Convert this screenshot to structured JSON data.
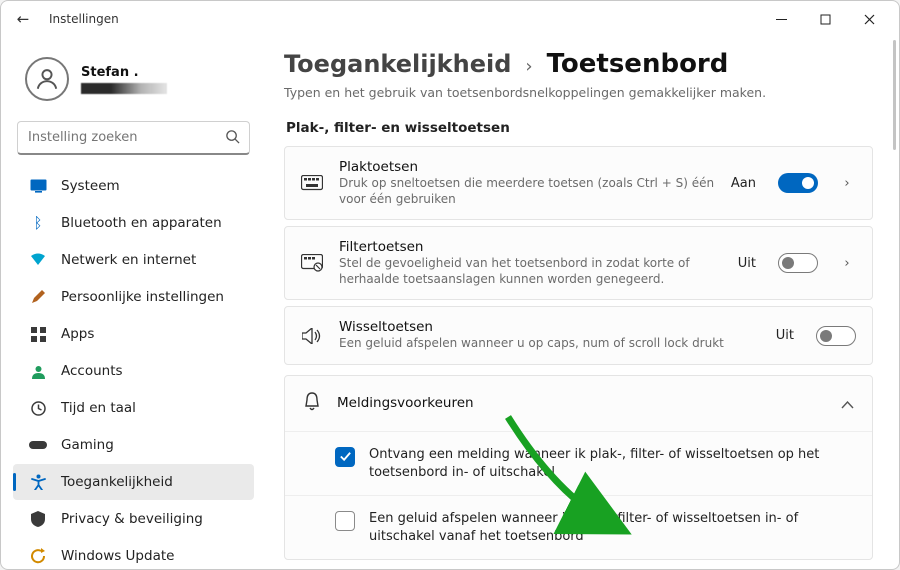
{
  "window": {
    "title": "Instellingen"
  },
  "profile": {
    "name": "Stefan ."
  },
  "search": {
    "placeholder": "Instelling zoeken"
  },
  "sidebar": {
    "items": [
      {
        "icon": "display",
        "label": "Systeem",
        "color": "#0067c0"
      },
      {
        "icon": "bluetooth",
        "label": "Bluetooth en apparaten",
        "color": "#0067c0"
      },
      {
        "icon": "wifi",
        "label": "Netwerk en internet",
        "color": "#00a4cf"
      },
      {
        "icon": "brush",
        "label": "Persoonlijke instellingen",
        "color": "#b1621f"
      },
      {
        "icon": "apps",
        "label": "Apps",
        "color": "#3a3a3a"
      },
      {
        "icon": "person",
        "label": "Accounts",
        "color": "#1f9c5d"
      },
      {
        "icon": "clock",
        "label": "Tijd en taal",
        "color": "#3a3a3a"
      },
      {
        "icon": "gamepad",
        "label": "Gaming",
        "color": "#3a3a3a"
      },
      {
        "icon": "accessibility",
        "label": "Toegankelijkheid",
        "color": "#0067c0",
        "active": true
      },
      {
        "icon": "shield",
        "label": "Privacy & beveiliging",
        "color": "#3a3a3a"
      },
      {
        "icon": "update",
        "label": "Windows Update",
        "color": "#d28a00"
      }
    ]
  },
  "breadcrumb": {
    "parent": "Toegankelijkheid",
    "current": "Toetsenbord"
  },
  "subdesc": "Typen en het gebruik van toetsenbordsnelkoppelingen gemakkelijker maken.",
  "section_label": "Plak-, filter- en wisseltoetsen",
  "rows": [
    {
      "title": "Plaktoetsen",
      "desc": "Druk op sneltoetsen die meerdere toetsen (zoals Ctrl + S) één voor één gebruiken",
      "state": "Aan",
      "on": true,
      "chevron": true
    },
    {
      "title": "Filtertoetsen",
      "desc": "Stel de gevoeligheid van het toetsenbord in zodat korte of herhaalde toetsaanslagen kunnen worden genegeerd.",
      "state": "Uit",
      "on": false,
      "chevron": true
    },
    {
      "title": "Wisseltoetsen",
      "desc": "Een geluid afspelen wanneer u op caps, num of scroll lock drukt",
      "state": "Uit",
      "on": false,
      "chevron": false
    }
  ],
  "expander": {
    "title": "Meldingsvoorkeuren",
    "items": [
      {
        "checked": true,
        "label": "Ontvang een melding wanneer ik plak-, filter- of wisseltoetsen op het toetsenbord in- of uitschakel"
      },
      {
        "checked": false,
        "label": "Een geluid afspelen wanneer ik plak-, filter- of wisseltoetsen in- of uitschakel vanaf het toetsenbord"
      }
    ]
  },
  "colors": {
    "accent": "#0067c0",
    "arrow": "#18a122"
  }
}
